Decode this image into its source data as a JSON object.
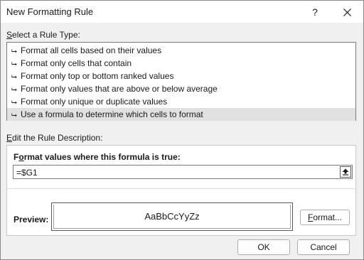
{
  "window": {
    "title": "New Formatting Rule",
    "help_label": "?",
    "close_icon": "close-icon"
  },
  "rule_type": {
    "label": "Select a Rule Type:",
    "label_mnemonic": "S",
    "label_rest": "elect a Rule Type:",
    "items": [
      {
        "label": "Format all cells based on their values",
        "selected": false
      },
      {
        "label": "Format only cells that contain",
        "selected": false
      },
      {
        "label": "Format only top or bottom ranked values",
        "selected": false
      },
      {
        "label": "Format only values that are above or below average",
        "selected": false
      },
      {
        "label": "Format only unique or duplicate values",
        "selected": false
      },
      {
        "label": "Use a formula to determine which cells to format",
        "selected": true
      }
    ],
    "item_icon": "arrow-right-icon"
  },
  "description": {
    "label": "Edit the Rule Description:",
    "label_mnemonic": "E",
    "label_rest": "dit the Rule Description:",
    "formula_label": "Format values where this formula is true:",
    "formula_label_mnemonic": "o",
    "formula_label_pre": "F",
    "formula_label_post": "rmat values where this formula is true:",
    "formula_value": "=$G1",
    "collapse_icon": "collapse-dialog-icon",
    "preview_label": "Preview:",
    "preview_sample": "AaBbCcYyZz",
    "format_button_mnemonic": "F",
    "format_button_rest": "ormat..."
  },
  "buttons": {
    "ok": "OK",
    "cancel": "Cancel"
  },
  "colors": {
    "selected_row": "#e1e1e1",
    "dialog_bg": "#f0f0f0"
  }
}
